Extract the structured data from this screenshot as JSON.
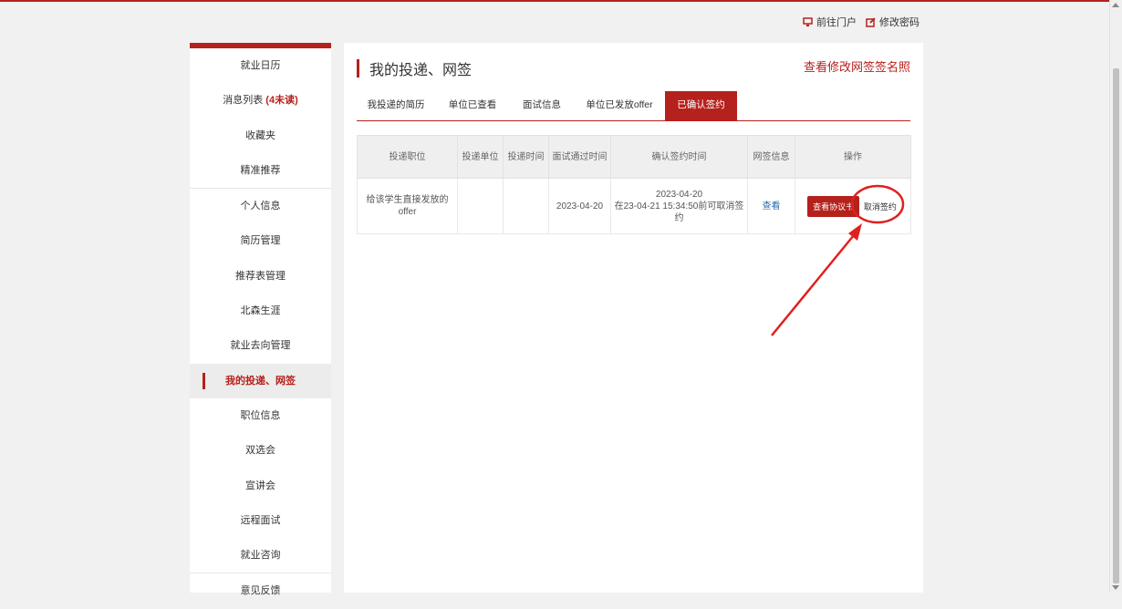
{
  "top_links": {
    "portal": "前往门户",
    "change_password": "修改密码"
  },
  "sidebar": {
    "items": [
      {
        "label": "就业日历"
      },
      {
        "label": "消息列表",
        "badge": "(4未读)"
      },
      {
        "label": "收藏夹"
      },
      {
        "label": "精准推荐"
      },
      {
        "label": "个人信息"
      },
      {
        "label": "简历管理"
      },
      {
        "label": "推荐表管理"
      },
      {
        "label": "北森生涯"
      },
      {
        "label": "就业去向管理"
      },
      {
        "label": "我的投递、网签",
        "active": true
      },
      {
        "label": "职位信息"
      },
      {
        "label": "双选会"
      },
      {
        "label": "宣讲会"
      },
      {
        "label": "远程面试"
      },
      {
        "label": "就业咨询"
      },
      {
        "label": "意见反馈"
      }
    ]
  },
  "main": {
    "title": "我的投递、网签",
    "photo_link": "查看修改网签签名照",
    "tabs": [
      {
        "label": "我投递的简历"
      },
      {
        "label": "单位已查看"
      },
      {
        "label": "面试信息"
      },
      {
        "label": "单位已发放offer"
      },
      {
        "label": "已确认签约",
        "active": true
      }
    ],
    "table": {
      "headers": [
        "投递职位",
        "投递单位",
        "投递时间",
        "面试通过时间",
        "确认签约时间",
        "网签信息",
        "操作"
      ],
      "rows": [
        {
          "position": "给该学生直接发放的offer",
          "company": "",
          "apply_time": "",
          "interview_pass_time": "2023-04-20",
          "confirm_date": "2023-04-20",
          "confirm_note": "在23-04-21 15:34:50前可取消签约",
          "sign_info": "查看",
          "action_view": "查看协议书",
          "action_cancel": "取消签约"
        }
      ]
    }
  },
  "annotation": {
    "color": "#e02020",
    "shape": "circle-and-arrow"
  }
}
